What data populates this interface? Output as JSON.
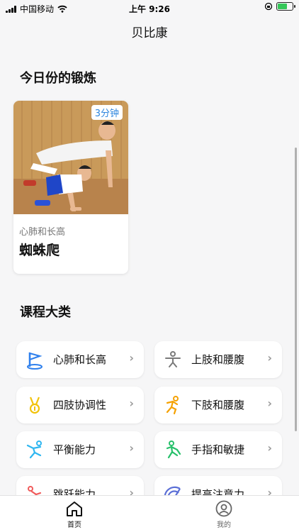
{
  "status_bar": {
    "carrier": "中国移动",
    "time": "上午 9:26"
  },
  "nav": {
    "title": "贝比康"
  },
  "today": {
    "section_title": "今日份的锻炼",
    "card": {
      "duration": "3分钟",
      "category": "心肺和长高",
      "name": "蜘蛛爬"
    }
  },
  "categories": {
    "section_title": "课程大类",
    "items": [
      {
        "label": "心肺和长高",
        "icon": "flag-icon",
        "color": "#2f80ed"
      },
      {
        "label": "上肢和腰腹",
        "icon": "stretch-figure-icon",
        "color": "#7a7a7a"
      },
      {
        "label": "四肢协调性",
        "icon": "medal-icon",
        "color": "#f2c20a"
      },
      {
        "label": "下肢和腰腹",
        "icon": "running-figure-icon",
        "color": "#f5a100"
      },
      {
        "label": "平衡能力",
        "icon": "balance-figure-icon",
        "color": "#2eb6f0"
      },
      {
        "label": "手指和敏捷",
        "icon": "agility-figure-icon",
        "color": "#27c06a"
      },
      {
        "label": "跳跃能力",
        "icon": "jump-figure-icon",
        "color": "#f05a5a"
      },
      {
        "label": "提高注意力",
        "icon": "focus-icon",
        "color": "#5b6fd6"
      }
    ]
  },
  "tabs": [
    {
      "label": "首页",
      "icon": "home-icon",
      "active": true
    },
    {
      "label": "我的",
      "icon": "profile-icon",
      "active": false
    }
  ]
}
